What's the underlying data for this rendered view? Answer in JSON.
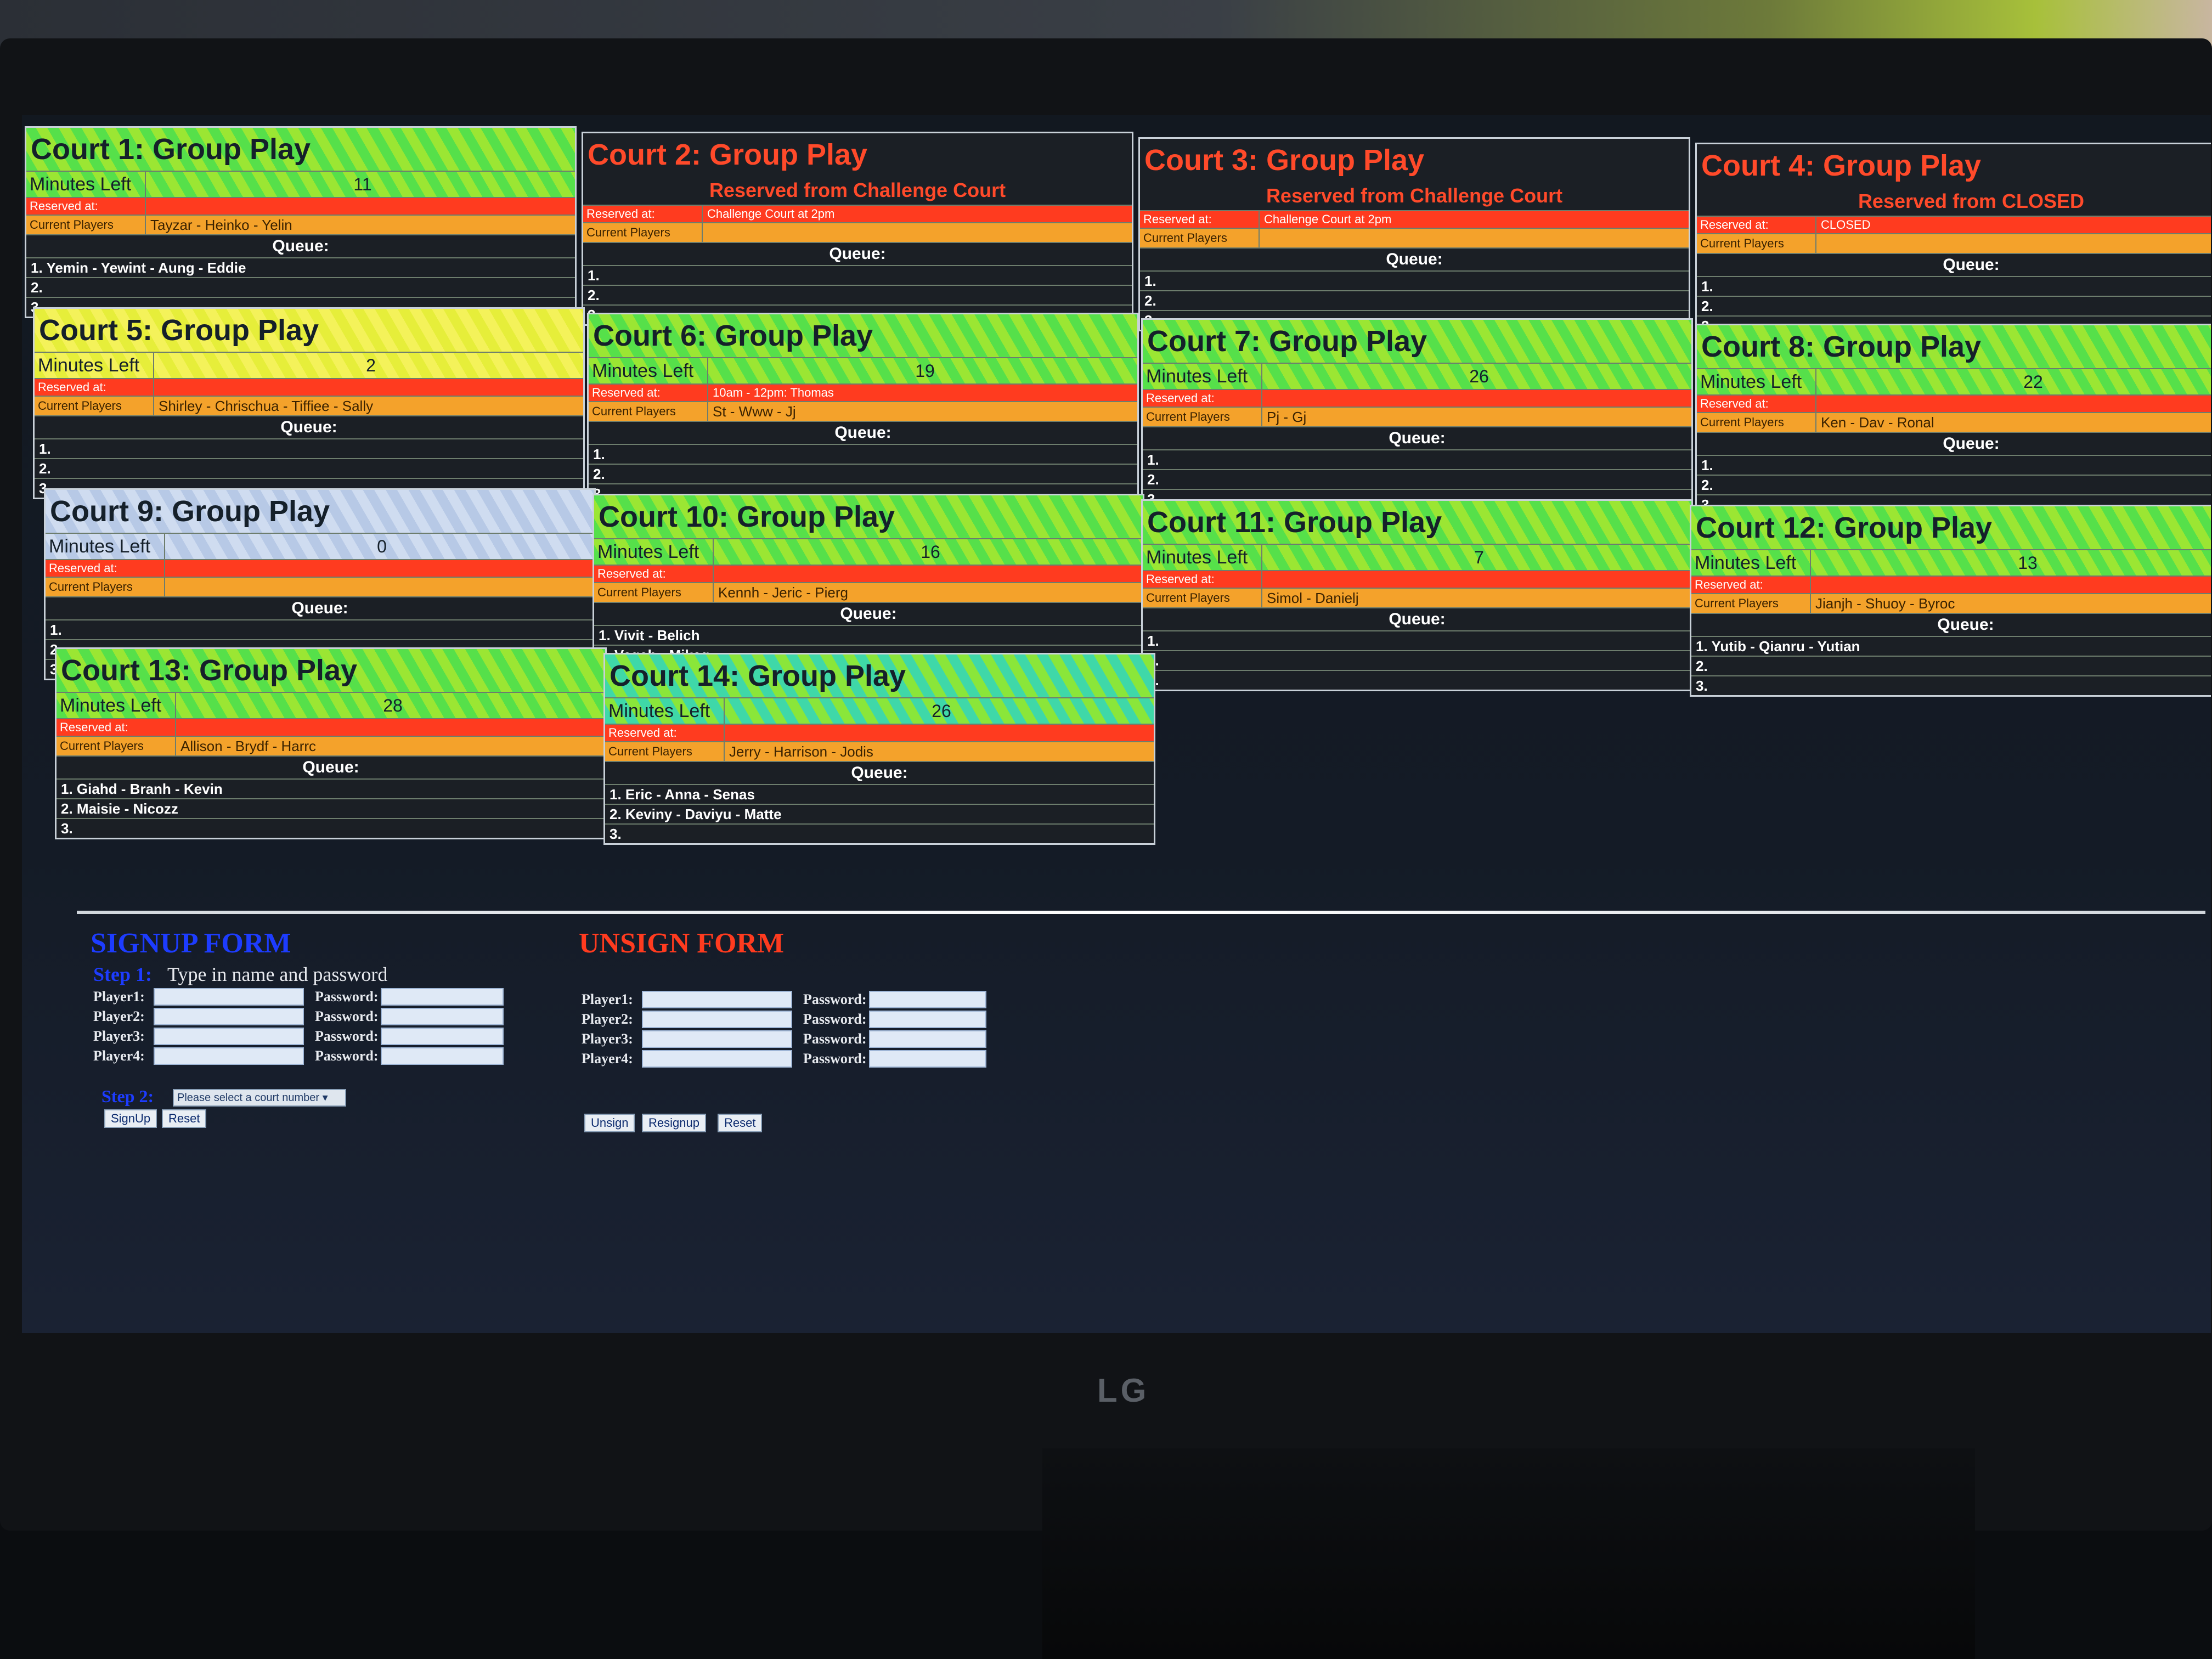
{
  "brand": "LG",
  "courts": [
    {
      "title": "Court 1: Group Play",
      "style": "green",
      "minutes_label": "Minutes Left",
      "minutes": "11",
      "reserved_label": "Reserved at:",
      "reserved": "",
      "current_label": "Current Players",
      "current": "Tayzar - Heinko - Yelin",
      "queue_label": "Queue:",
      "queue": [
        "1. Yemin - Yewint - Aung - Eddie",
        "2.",
        "3."
      ]
    },
    {
      "title": "Court 2: Group Play",
      "style": "red",
      "subtitle": "Reserved from Challenge Court",
      "reserved_label": "Reserved at:",
      "reserved": "Challenge Court at 2pm",
      "current_label": "Current Players",
      "current": "",
      "queue_label": "Queue:",
      "queue": [
        "1.",
        "2.",
        "3."
      ]
    },
    {
      "title": "Court 3: Group Play",
      "style": "red",
      "subtitle": "Reserved from Challenge Court",
      "reserved_label": "Reserved at:",
      "reserved": "Challenge Court at 2pm",
      "current_label": "Current Players",
      "current": "",
      "queue_label": "Queue:",
      "queue": [
        "1.",
        "2.",
        "3."
      ]
    },
    {
      "title": "Court 4: Group Play",
      "style": "red",
      "subtitle": "Reserved from CLOSED",
      "reserved_label": "Reserved at:",
      "reserved": "CLOSED",
      "current_label": "Current Players",
      "current": "",
      "queue_label": "Queue:",
      "queue": [
        "1.",
        "2.",
        "3."
      ]
    },
    {
      "title": "Court 5: Group Play",
      "style": "yellow",
      "minutes_label": "Minutes Left",
      "minutes": "2",
      "reserved_label": "Reserved at:",
      "reserved": "",
      "current_label": "Current Players",
      "current": "Shirley - Chrischua - Tiffiee - Sally",
      "queue_label": "Queue:",
      "queue": [
        "1.",
        "2.",
        "3."
      ]
    },
    {
      "title": "Court 6: Group Play",
      "style": "green",
      "minutes_label": "Minutes Left",
      "minutes": "19",
      "reserved_label": "Reserved at:",
      "reserved": "10am - 12pm: Thomas",
      "current_label": "Current Players",
      "current": "St - Www - Jj",
      "queue_label": "Queue:",
      "queue": [
        "1.",
        "2.",
        "3."
      ]
    },
    {
      "title": "Court 7: Group Play",
      "style": "green",
      "minutes_label": "Minutes Left",
      "minutes": "26",
      "reserved_label": "Reserved at:",
      "reserved": "",
      "current_label": "Current Players",
      "current": "Pj - Gj",
      "queue_label": "Queue:",
      "queue": [
        "1.",
        "2.",
        "3."
      ]
    },
    {
      "title": "Court 8: Group Play",
      "style": "green",
      "minutes_label": "Minutes Left",
      "minutes": "22",
      "reserved_label": "Reserved at:",
      "reserved": "",
      "current_label": "Current Players",
      "current": "Ken - Dav - Ronal",
      "queue_label": "Queue:",
      "queue": [
        "1.",
        "2.",
        "3."
      ]
    },
    {
      "title": "Court 9: Group Play",
      "style": "blue",
      "minutes_label": "Minutes Left",
      "minutes": "0",
      "reserved_label": "Reserved at:",
      "reserved": "",
      "current_label": "Current Players",
      "current": "",
      "queue_label": "Queue:",
      "queue": [
        "1.",
        "2.",
        "3."
      ]
    },
    {
      "title": "Court 10: Group Play",
      "style": "green",
      "minutes_label": "Minutes Left",
      "minutes": "16",
      "reserved_label": "Reserved at:",
      "reserved": "",
      "current_label": "Current Players",
      "current": "Kennh - Jeric - Pierg",
      "queue_label": "Queue:",
      "queue": [
        "1. Vivit - Belich",
        "2. Vegah - Mikeg",
        "3."
      ]
    },
    {
      "title": "Court 11: Group Play",
      "style": "green",
      "minutes_label": "Minutes Left",
      "minutes": "7",
      "reserved_label": "Reserved at:",
      "reserved": "",
      "current_label": "Current Players",
      "current": "Simol - Danielj",
      "queue_label": "Queue:",
      "queue": [
        "1.",
        "2.",
        "3."
      ]
    },
    {
      "title": "Court 12: Group Play",
      "style": "green",
      "minutes_label": "Minutes Left",
      "minutes": "13",
      "reserved_label": "Reserved at:",
      "reserved": "",
      "current_label": "Current Players",
      "current": "Jianjh - Shuoy - Byroc",
      "queue_label": "Queue:",
      "queue": [
        "1. Yutib - Qianru - Yutian",
        "2.",
        "3."
      ]
    },
    {
      "title": "Court 13: Group Play",
      "style": "green",
      "minutes_label": "Minutes Left",
      "minutes": "28",
      "reserved_label": "Reserved at:",
      "reserved": "",
      "current_label": "Current Players",
      "current": "Allison - Brydf - Harrc",
      "queue_label": "Queue:",
      "queue": [
        "1. Giahd - Branh - Kevin",
        "2. Maisie - Nicozz",
        "3."
      ]
    },
    {
      "title": "Court 14: Group Play",
      "style": "cyan",
      "minutes_label": "Minutes Left",
      "minutes": "26",
      "reserved_label": "Reserved at:",
      "reserved": "",
      "current_label": "Current Players",
      "current": "Jerry - Harrison - Jodis",
      "queue_label": "Queue:",
      "queue": [
        "1. Eric - Anna - Senas",
        "2. Keviny - Daviyu - Matte",
        "3."
      ]
    }
  ],
  "signup": {
    "title": "SIGNUP FORM",
    "step1_label": "Step 1:",
    "step1_text": "Type in name and password",
    "players": [
      "Player1:",
      "Player2:",
      "Player3:",
      "Player4:"
    ],
    "password_label": "Password:",
    "step2_label": "Step 2:",
    "select_value": "Please select a court number",
    "signup_button": "SignUp",
    "reset_button": "Reset"
  },
  "unsign": {
    "title": "UNSIGN FORM",
    "players": [
      "Player1:",
      "Player2:",
      "Player3:",
      "Player4:"
    ],
    "password_label": "Password:",
    "unsign_button": "Unsign",
    "resignup_button": "Resignup",
    "reset_button": "Reset"
  },
  "colors": {
    "signup_title": "#1d3cff",
    "unsign_title": "#ff3b1f",
    "reserved": "#ff3b1f",
    "current": "#f4a22b"
  }
}
